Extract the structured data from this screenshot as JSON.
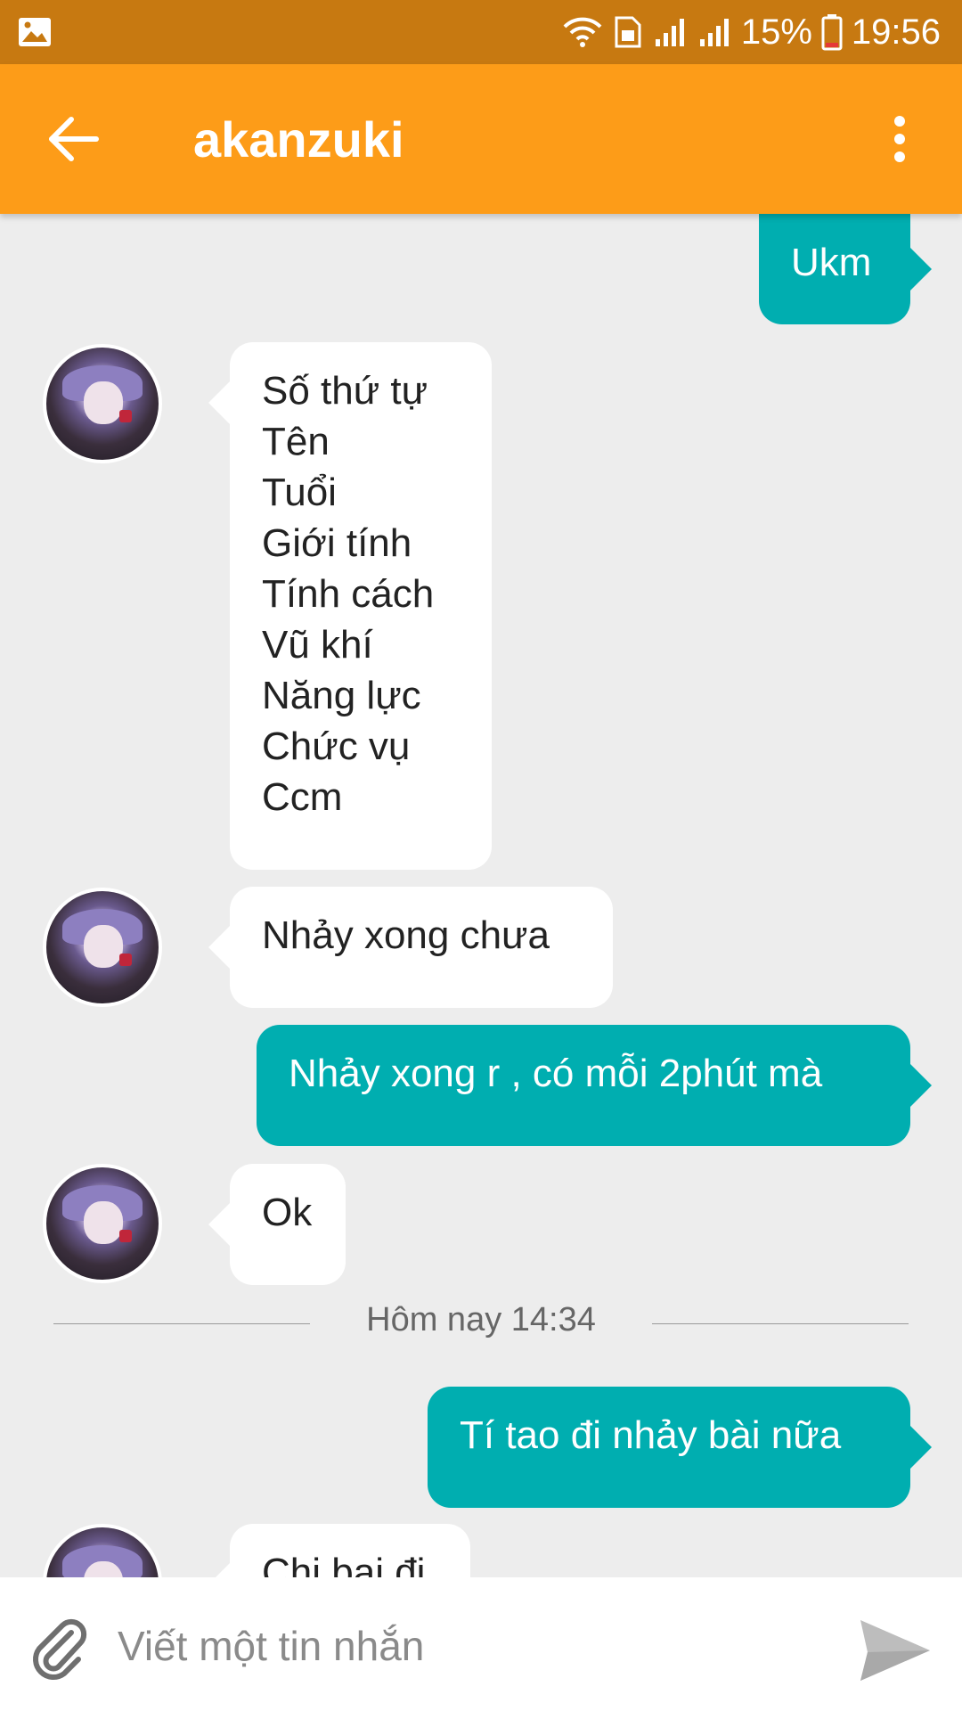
{
  "status_bar": {
    "battery": "15%",
    "time": "19:56"
  },
  "header": {
    "title": "akanzuki"
  },
  "messages": [
    {
      "side": "out",
      "text": "Ukm"
    },
    {
      "side": "in",
      "lines": [
        "Số thứ tự",
        "Tên",
        "Tuổi",
        "Giới tính",
        "Tính cách",
        "Vũ khí",
        "Năng lực",
        "Chức vụ",
        "Ccm"
      ]
    },
    {
      "side": "in",
      "text": "Nhảy xong chưa"
    },
    {
      "side": "out",
      "text": "Nhảy xong r , có mỗi 2phút mà"
    },
    {
      "side": "in",
      "text": "Ok"
    },
    {
      "side": "out",
      "text": "Tí tao đi nhảy bài nữa"
    },
    {
      "side": "in",
      "text": "Chi bai đi"
    }
  ],
  "date_separator": "Hôm nay 14:34",
  "composer": {
    "placeholder": "Viết một tin nhắn"
  },
  "colors": {
    "status_bar": "#c77911",
    "app_bar": "#fd9c18",
    "outgoing_bubble": "#00aeb0",
    "incoming_bubble": "#ffffff",
    "background": "#ededed"
  },
  "icons": [
    "gallery-icon",
    "wifi-icon",
    "sim-icon",
    "signal-icon",
    "battery-icon",
    "back-arrow-icon",
    "more-vert-icon",
    "paperclip-icon",
    "send-icon"
  ]
}
